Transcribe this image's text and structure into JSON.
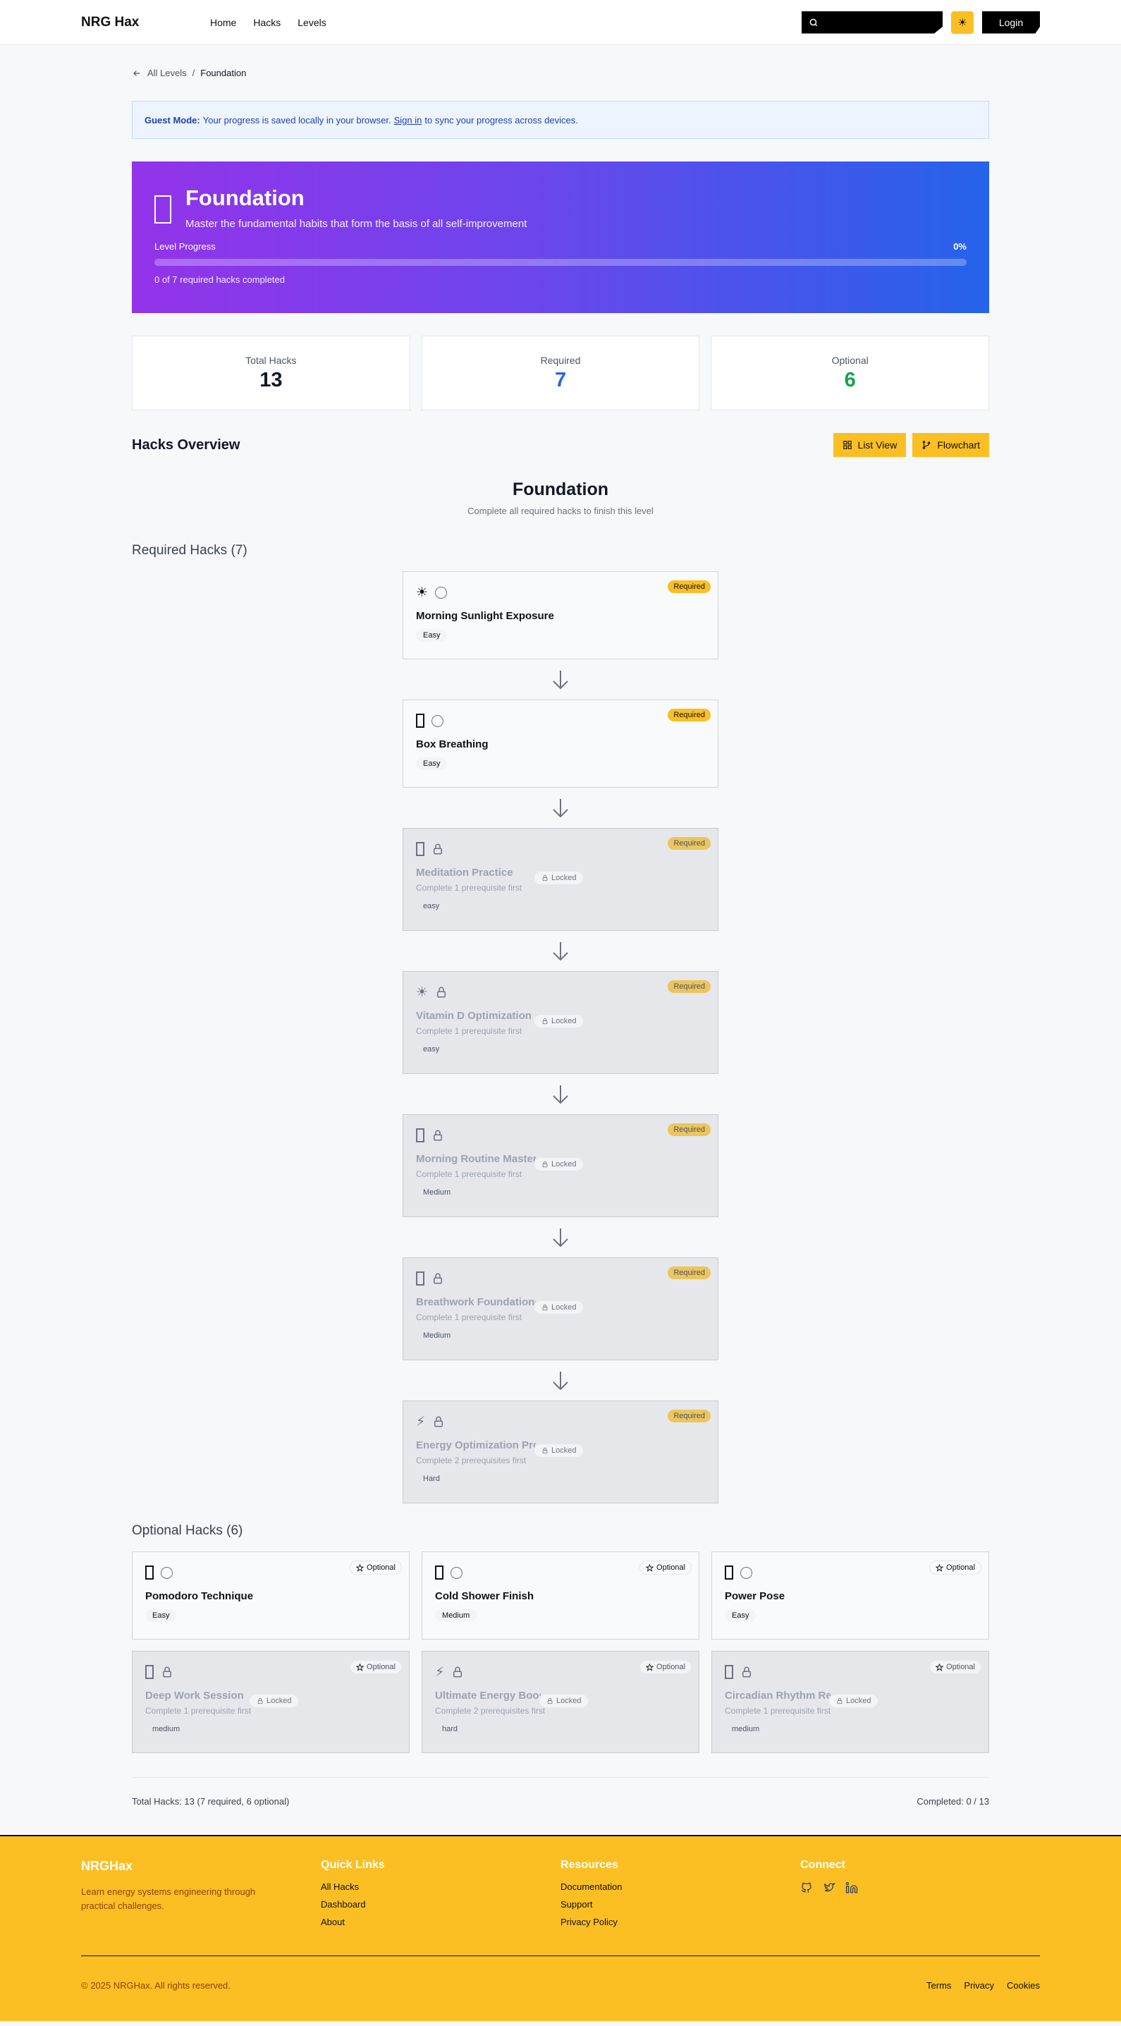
{
  "nav": {
    "brand": "NRG Hax",
    "links": [
      "Home",
      "Hacks",
      "Levels"
    ],
    "search_placeholder": "",
    "login": "Login"
  },
  "breadcrumb": {
    "back": "All Levels",
    "sep": "/",
    "current": "Foundation"
  },
  "guest": {
    "label": "Guest Mode:",
    "text_before": "Your progress is saved locally in your browser.",
    "link": "Sign in",
    "text_after": "to sync your progress across devices."
  },
  "level": {
    "title": "Foundation",
    "subtitle": "Master the fundamental habits that form the basis of all self-improvement",
    "progress_label": "Level Progress",
    "progress_pct": "0%",
    "progress_value": 0,
    "progress_note": "0 of 7 required hacks completed"
  },
  "stats": [
    {
      "label": "Total Hacks",
      "value": "13",
      "color": "#111827"
    },
    {
      "label": "Required",
      "value": "7",
      "color": "#2563eb"
    },
    {
      "label": "Optional",
      "value": "6",
      "color": "#16a34a"
    }
  ],
  "overview": {
    "title": "Hacks Overview",
    "list_view": "List View",
    "flowchart": "Flowchart",
    "flow_title": "Foundation",
    "flow_sub": "Complete all required hacks to finish this level"
  },
  "required": {
    "title": "Required Hacks (7)",
    "badge": "Required",
    "locked_label": "Locked",
    "items": [
      {
        "name": "Morning Sunlight Exposure",
        "difficulty": "Easy",
        "icon": "sun-icon",
        "glyph": "☀",
        "locked": false,
        "note": ""
      },
      {
        "name": "Box Breathing",
        "difficulty": "Easy",
        "icon": "box-icon",
        "glyph": "",
        "locked": false,
        "note": ""
      },
      {
        "name": "Meditation Practice",
        "difficulty": "easy",
        "icon": "box-icon",
        "glyph": "",
        "locked": true,
        "note": "Complete 1 prerequisite first"
      },
      {
        "name": "Vitamin D Optimization",
        "difficulty": "easy",
        "icon": "sun-icon",
        "glyph": "☀",
        "locked": true,
        "note": "Complete 1 prerequisite first"
      },
      {
        "name": "Morning Routine Mastery",
        "difficulty": "Medium",
        "icon": "box-icon",
        "glyph": "",
        "locked": true,
        "note": "Complete 1 prerequisite first"
      },
      {
        "name": "Breathwork Foundations",
        "difficulty": "Medium",
        "icon": "box-icon",
        "glyph": "",
        "locked": true,
        "note": "Complete 1 prerequisite first"
      },
      {
        "name": "Energy Optimization Protocol",
        "difficulty": "Hard",
        "icon": "lightning-icon",
        "glyph": "⚡",
        "locked": true,
        "note": "Complete 2 prerequisites first"
      }
    ]
  },
  "optional": {
    "title": "Optional Hacks (6)",
    "badge": "Optional",
    "locked_label": "Locked",
    "items": [
      {
        "name": "Pomodoro Technique",
        "difficulty": "Easy",
        "icon": "box-icon",
        "glyph": "",
        "locked": false,
        "note": ""
      },
      {
        "name": "Cold Shower Finish",
        "difficulty": "Medium",
        "icon": "box-icon",
        "glyph": "",
        "locked": false,
        "note": ""
      },
      {
        "name": "Power Pose",
        "difficulty": "Easy",
        "icon": "box-icon",
        "glyph": "",
        "locked": false,
        "note": ""
      },
      {
        "name": "Deep Work Session",
        "difficulty": "medium",
        "icon": "box-icon",
        "glyph": "",
        "locked": true,
        "note": "Complete 1 prerequisite first"
      },
      {
        "name": "Ultimate Energy Boost",
        "difficulty": "hard",
        "icon": "lightning-icon",
        "glyph": "⚡",
        "locked": true,
        "note": "Complete 2 prerequisites first"
      },
      {
        "name": "Circadian Rhythm Reset",
        "difficulty": "medium",
        "icon": "box-icon",
        "glyph": "",
        "locked": true,
        "note": "Complete 1 prerequisite first"
      }
    ]
  },
  "summary": {
    "left": "Total Hacks: 13 (7 required, 6 optional)",
    "right": "Completed: 0 / 13"
  },
  "footer": {
    "brand": "NRGHax",
    "desc": "Learn energy systems engineering through practical challenges.",
    "quick_title": "Quick Links",
    "quick_links": [
      "All Hacks",
      "Dashboard",
      "About"
    ],
    "resources_title": "Resources",
    "resources_links": [
      "Documentation",
      "Support",
      "Privacy Policy"
    ],
    "connect_title": "Connect",
    "social": [
      "github-icon",
      "twitter-icon",
      "linkedin-icon"
    ],
    "copyright": "© 2025 NRGHax. All rights reserved.",
    "legal": [
      "Terms",
      "Privacy",
      "Cookies"
    ]
  }
}
